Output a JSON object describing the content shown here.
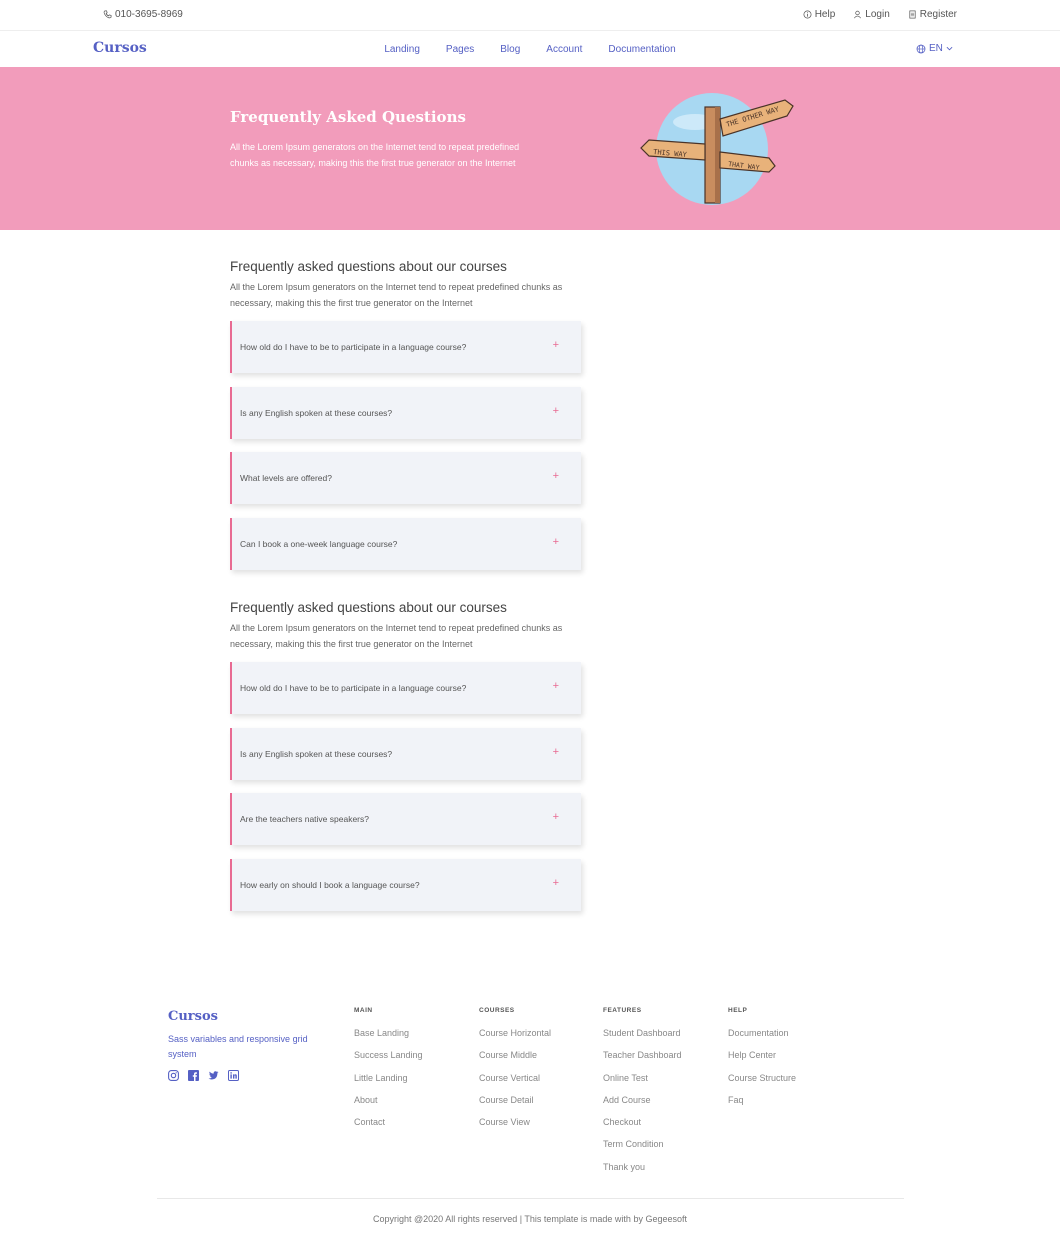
{
  "topbar": {
    "phone": "010-3695-8969",
    "help": "Help",
    "login": "Login",
    "register": "Register"
  },
  "nav": {
    "brand": "Cursos",
    "links": [
      "Landing",
      "Pages",
      "Blog",
      "Account",
      "Documentation"
    ],
    "language": "EN"
  },
  "hero": {
    "title": "Frequently Asked Questions",
    "text": "All the Lorem Ipsum generators on the Internet tend to repeat predefined chunks as necessary, making this the first true generator on the Internet",
    "sign_labels": [
      "THE OTHER WAY",
      "THIS WAY",
      "THAT WAY"
    ],
    "background": "#f29cbb"
  },
  "faq_sections": [
    {
      "heading": "Frequently asked questions about our courses",
      "description": "All the Lorem Ipsum generators on the Internet tend to repeat predefined chunks as necessary, making this the first true generator on the Internet",
      "questions": [
        "How old do I have to be to participate in a language course?",
        "Is any English spoken at these courses?",
        "What levels are offered?",
        "Can I book a one-week language course?"
      ]
    },
    {
      "heading": "Frequently asked questions about our courses",
      "description": "All the Lorem Ipsum generators on the Internet tend to repeat predefined chunks as necessary, making this the first true generator on the Internet",
      "questions": [
        "How old do I have to be to participate in a language course?",
        "Is any English spoken at these courses?",
        "Are the teachers native speakers?",
        "How early on should I book a language course?"
      ]
    }
  ],
  "footer": {
    "brand": "Cursos",
    "tagline": "Sass variables and responsive grid system",
    "social": [
      "instagram-icon",
      "facebook-icon",
      "twitter-icon",
      "linkedin-icon"
    ],
    "columns": [
      {
        "title": "MAIN",
        "links": [
          "Base Landing",
          "Success Landing",
          "Little Landing",
          "About",
          "Contact"
        ]
      },
      {
        "title": "COURSES",
        "links": [
          "Course Horizontal",
          "Course Middle",
          "Course Vertical",
          "Course Detail",
          "Course View"
        ]
      },
      {
        "title": "FEATURES",
        "links": [
          "Student Dashboard",
          "Teacher Dashboard",
          "Online Test",
          "Add Course",
          "Checkout",
          "Term Condition",
          "Thank you"
        ]
      },
      {
        "title": "HELP",
        "links": [
          "Documentation",
          "Help Center",
          "Course Structure",
          "Faq"
        ]
      }
    ],
    "copyright": "Copyright @2020 All rights reserved | This template is made with by Gegeesoft"
  },
  "colors": {
    "brand": "#5560c4",
    "accent": "#e86a92",
    "card_bg": "#f1f3f8"
  }
}
